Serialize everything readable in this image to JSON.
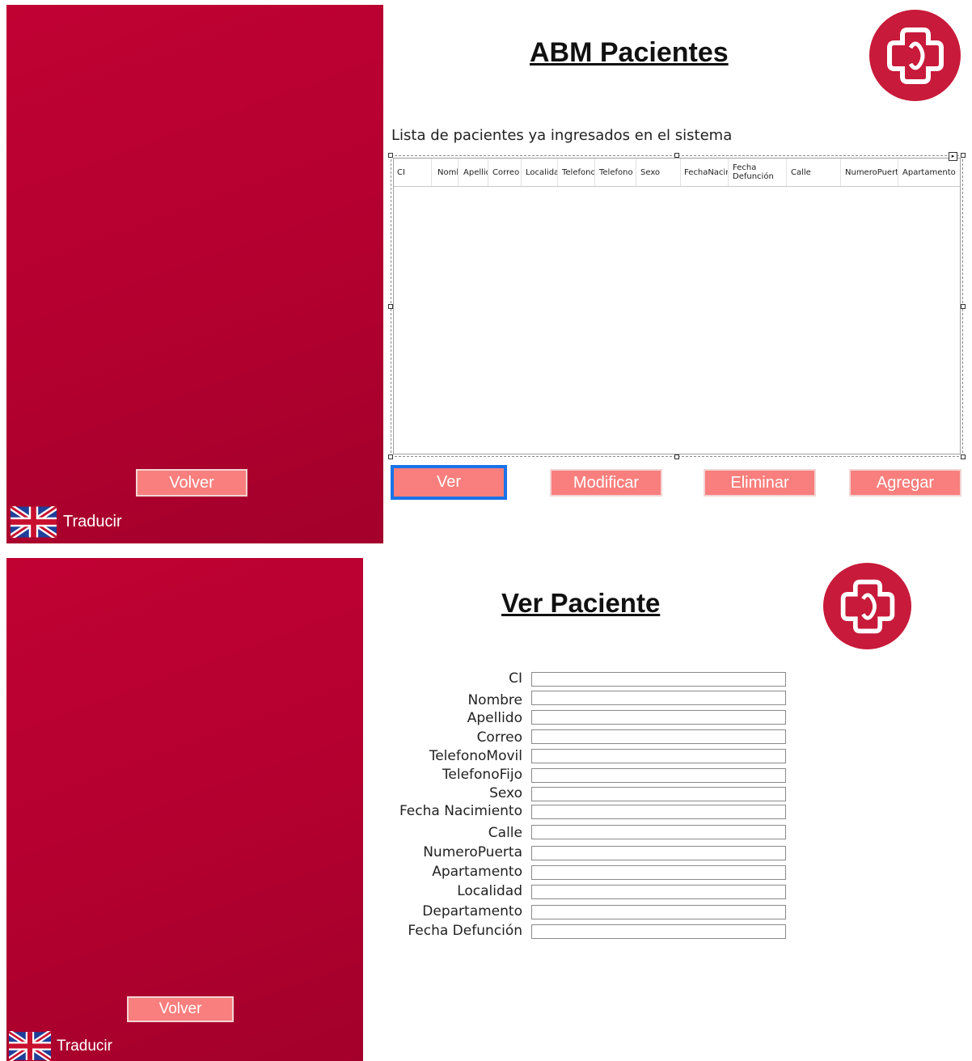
{
  "abm": {
    "title": "ABM Pacientes",
    "list_caption": "Lista de pacientes ya ingresados en el sistema",
    "columns": [
      {
        "label": "CI"
      },
      {
        "label": "Nombre"
      },
      {
        "label": "Apellido"
      },
      {
        "label": "Correo"
      },
      {
        "label": "Localidad"
      },
      {
        "label": "Telefono"
      },
      {
        "label": "Telefono"
      },
      {
        "label": "Sexo"
      },
      {
        "label": "FechaNacimiento"
      },
      {
        "label": "Fecha Defunción"
      },
      {
        "label": "Calle"
      },
      {
        "label": "NumeroPuerta"
      },
      {
        "label": "Apartamento"
      }
    ],
    "buttons": {
      "ver": "Ver",
      "modificar": "Modificar",
      "eliminar": "Eliminar",
      "agregar": "Agregar"
    },
    "volver": "Volver",
    "translate": "Traducir"
  },
  "ver": {
    "title": "Ver Paciente",
    "fields": [
      {
        "label": "CI",
        "value": ""
      },
      {
        "label": "Nombre",
        "value": ""
      },
      {
        "label": "Apellido",
        "value": ""
      },
      {
        "label": "Correo",
        "value": ""
      },
      {
        "label": "TelefonoMovil",
        "value": ""
      },
      {
        "label": "TelefonoFijo",
        "value": ""
      },
      {
        "label": "Sexo",
        "value": ""
      },
      {
        "label": "Fecha Nacimiento",
        "value": ""
      },
      {
        "label": "Calle",
        "value": ""
      },
      {
        "label": "NumeroPuerta",
        "value": ""
      },
      {
        "label": "Apartamento",
        "value": ""
      },
      {
        "label": "Localidad",
        "value": ""
      },
      {
        "label": "Departamento",
        "value": ""
      },
      {
        "label": "Fecha Defunción",
        "value": ""
      }
    ],
    "volver": "Volver",
    "translate": "Traducir"
  },
  "colors": {
    "sidebar": "#b5002f",
    "button": "#f87f7d",
    "logo": "#c81a3a",
    "focus": "#1a73e8"
  },
  "icons": {
    "flag": "uk-flag-icon",
    "logo": "medical-cross-logo-icon"
  }
}
